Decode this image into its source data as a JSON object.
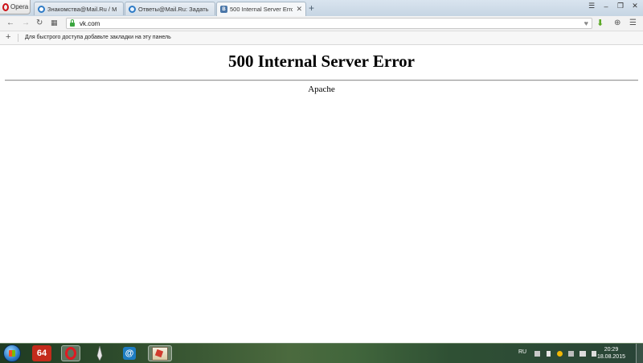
{
  "tabs": {
    "opera_label": "Opera",
    "items": [
      {
        "label": "Знакомства@Mail.Ru / М",
        "icon": "mail-favicon",
        "active": false
      },
      {
        "label": "Ответы@Mail.Ru: Задать",
        "icon": "answers-favicon",
        "active": false
      },
      {
        "label": "500 Internal Server Error",
        "icon": "vk-favicon",
        "active": true
      }
    ],
    "new_tab": "+"
  },
  "address": {
    "url": "vk.com"
  },
  "bookmarks": {
    "add": "+",
    "hint": "Для быстрого доступа добавьте закладки на эту панель"
  },
  "page": {
    "title": "500 Internal Server Error",
    "server": "Apache"
  },
  "taskbar": {
    "app_64_label": "64",
    "tray_lang": "RU",
    "clock_time": "20:29",
    "clock_date": "18.08.2015"
  },
  "colors": {
    "opera_red": "#cc0f16",
    "vk_blue": "#4a76a8",
    "secure_green": "#3aa53f"
  }
}
